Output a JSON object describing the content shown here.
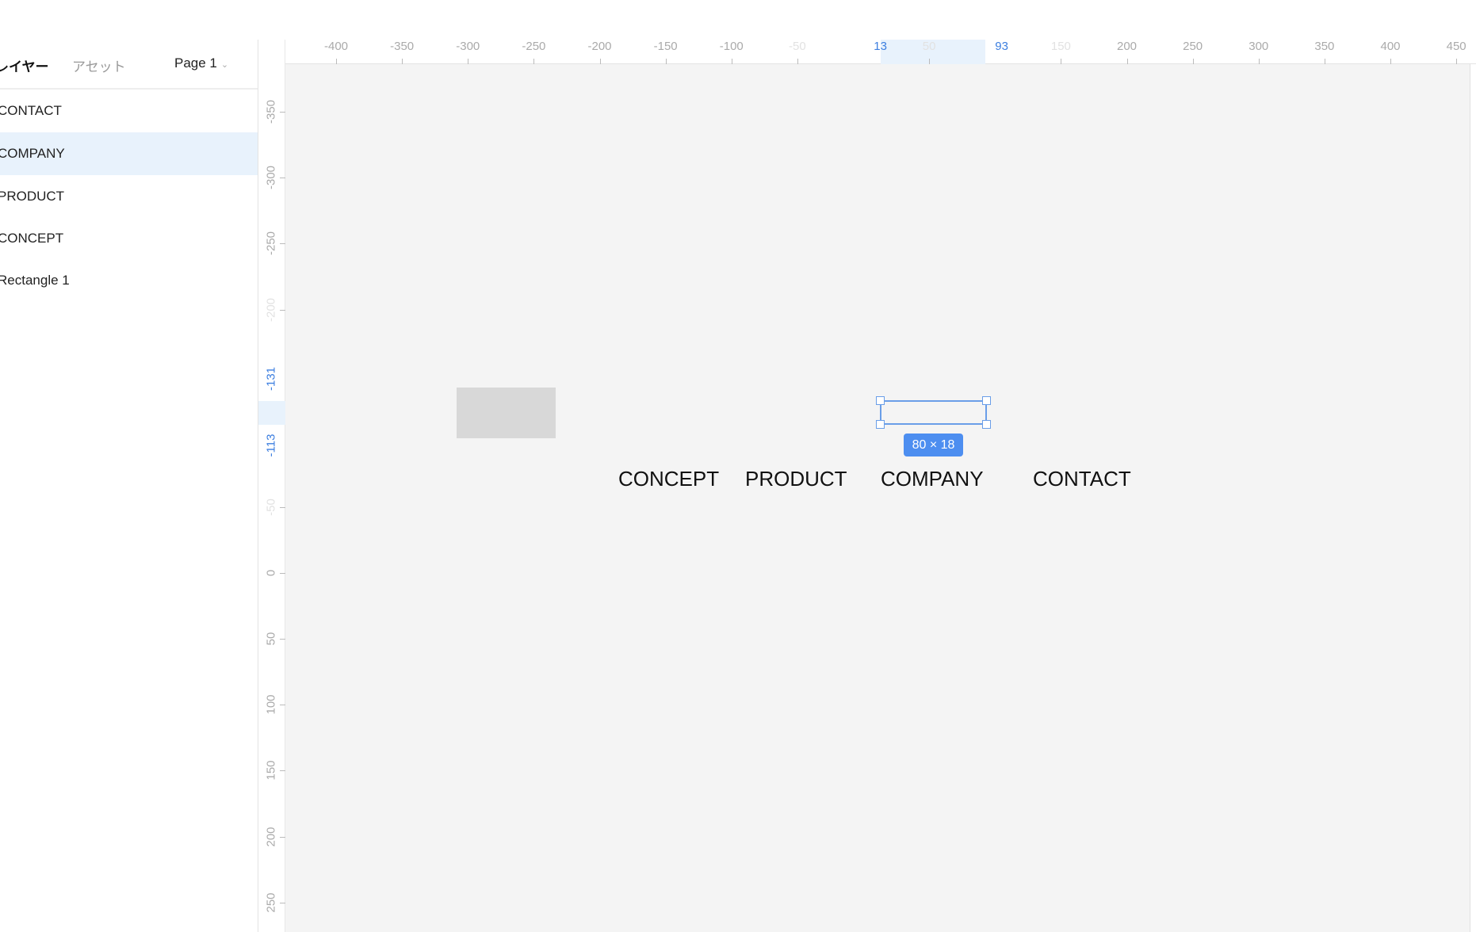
{
  "sidebar": {
    "tabs": {
      "layers": "レイヤー",
      "assets": "アセット"
    },
    "page": "Page 1",
    "layers": [
      {
        "label": "CONTACT",
        "selected": false
      },
      {
        "label": "COMPANY",
        "selected": true
      },
      {
        "label": "PRODUCT",
        "selected": false
      },
      {
        "label": "CONCEPT",
        "selected": false
      },
      {
        "label": "Rectangle 1",
        "selected": false
      }
    ]
  },
  "rulers": {
    "horizontal": [
      "-400",
      "-350",
      "-300",
      "-250",
      "-200",
      "-150",
      "-100",
      "-50",
      "50",
      "150",
      "200",
      "250",
      "300",
      "350",
      "400",
      "450"
    ],
    "horizontal_faded": [
      "-50",
      "50",
      "150"
    ],
    "horizontal_selection": [
      "13",
      "93"
    ],
    "vertical": [
      "-350",
      "-300",
      "-250",
      "-200",
      "-50",
      "0",
      "50",
      "100",
      "150",
      "200",
      "250"
    ],
    "vertical_faded": [
      "-200",
      "-50"
    ],
    "vertical_selection": [
      "-131",
      "-113"
    ]
  },
  "canvas": {
    "objects": [
      "CONCEPT",
      "PRODUCT",
      "COMPANY",
      "CONTACT"
    ],
    "selection_size": "80 × 18",
    "accent": "#4d8ef0"
  }
}
